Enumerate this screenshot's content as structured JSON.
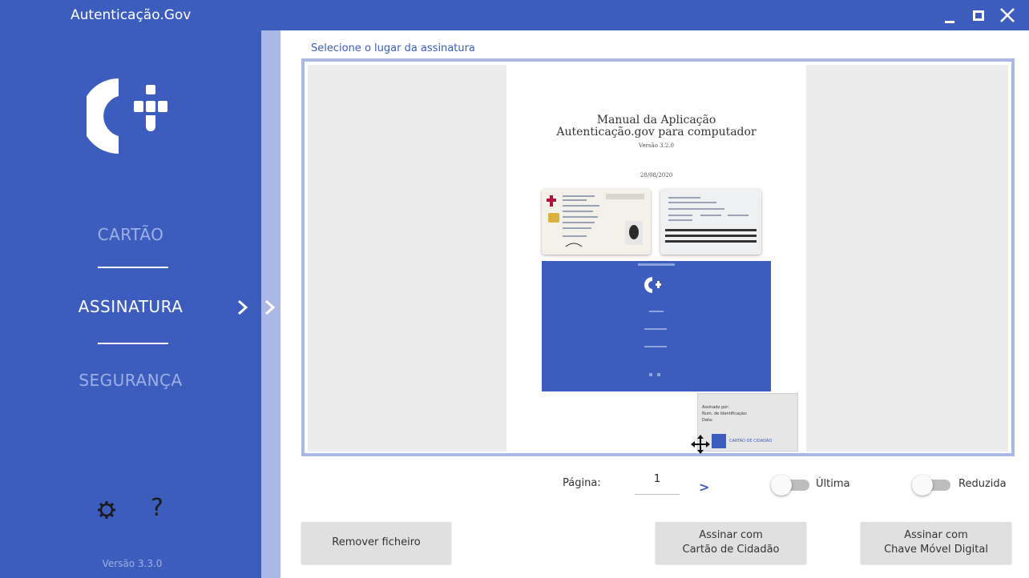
{
  "window": {
    "title": "Autenticação.Gov"
  },
  "sidebar": {
    "items": [
      {
        "label": "CARTÃO",
        "color": "#9fb0e4"
      },
      {
        "label": "ASSINATURA",
        "color": "#ffffff"
      },
      {
        "label": "SEGURANÇA",
        "color": "#9fb0e4"
      }
    ],
    "help_label": "?",
    "version": "Versão 3.3.0"
  },
  "main": {
    "section_label": "Selecione o lugar da assinatura",
    "document": {
      "title_line1": "Manual da Aplicação",
      "title_line2": "Autenticação.gov para computador",
      "version": "Versão 3.2.0",
      "date": "28/08/2020"
    },
    "signature_preview": {
      "line1": "Assinado por:",
      "line2": "Num. de Identificação:",
      "line3": "Data:",
      "brand": "CARTÃO DE CIDADÃO"
    }
  },
  "controls": {
    "page_label": "Página:",
    "page_value": "1",
    "next_label": ">",
    "last_label": "Última",
    "reduced_label": "Reduzida",
    "last_enabled": false,
    "reduced_enabled": false
  },
  "buttons": {
    "remove": "Remover ficheiro",
    "sign_cc_line1": "Assinar com",
    "sign_cc_line2": "Cartão de Cidadão",
    "sign_cmd_line1": "Assinar com",
    "sign_cmd_line2": "Chave Móvel Digital"
  },
  "colors": {
    "brand_blue": "#3c5dbd",
    "accent_light": "#a9b8e6"
  }
}
